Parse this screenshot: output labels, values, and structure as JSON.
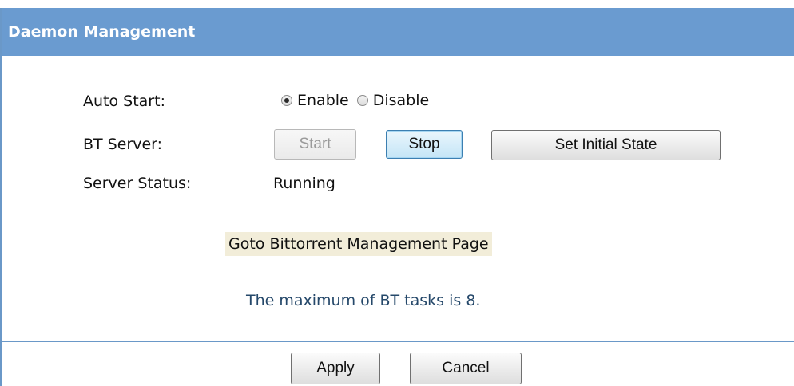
{
  "header": {
    "title": "Daemon Management"
  },
  "auto_start": {
    "label": "Auto Start:",
    "options": [
      {
        "label": "Enable",
        "checked": true
      },
      {
        "label": "Disable",
        "checked": false
      }
    ]
  },
  "bt_server": {
    "label": "BT Server:",
    "start_label": "Start",
    "start_disabled": true,
    "stop_label": "Stop",
    "set_initial_label": "Set Initial State"
  },
  "server_status": {
    "label": "Server Status:",
    "value": "Running"
  },
  "goto_link": "Goto Bittorrent Management Page",
  "info_text": "The maximum of BT tasks is 8.",
  "footer": {
    "apply_label": "Apply",
    "cancel_label": "Cancel"
  },
  "colors": {
    "header_bg": "#6a9bd0",
    "link_bg": "#f2edd9",
    "info_text": "#25486a"
  }
}
